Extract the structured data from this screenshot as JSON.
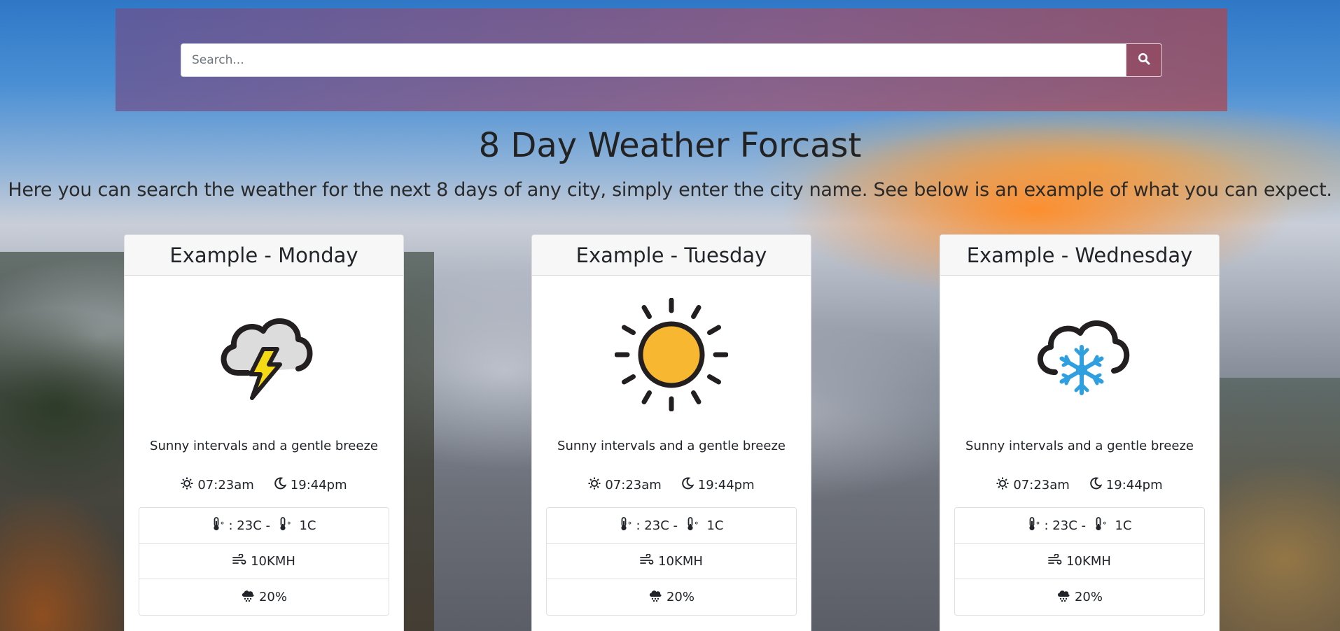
{
  "search": {
    "placeholder": "Search...",
    "button_icon": "search-icon"
  },
  "page": {
    "title": "8 Day Weather Forcast",
    "subtitle": "Here you can search the weather for the next 8 days of any city, simply enter the city name. See below is an example of what you can expect."
  },
  "cards": [
    {
      "title": "Example - Monday",
      "weather_icon": "thunderstorm-icon",
      "description": "Sunny intervals and a gentle breeze",
      "sunrise": "07:23am",
      "sunset": "19:44pm",
      "temp_label": ": 23C - ",
      "temp_low": " 1C",
      "wind": "10KMH",
      "rain": "20%"
    },
    {
      "title": "Example - Tuesday",
      "weather_icon": "sun-icon",
      "description": "Sunny intervals and a gentle breeze",
      "sunrise": "07:23am",
      "sunset": "19:44pm",
      "temp_label": ": 23C - ",
      "temp_low": " 1C",
      "wind": "10KMH",
      "rain": "20%"
    },
    {
      "title": "Example - Wednesday",
      "weather_icon": "snow-cloud-icon",
      "description": "Sunny intervals and a gentle breeze",
      "sunrise": "07:23am",
      "sunset": "19:44pm",
      "temp_label": ": 23C - ",
      "temp_low": " 1C",
      "wind": "10KMH",
      "rain": "20%"
    }
  ],
  "colors": {
    "sun_fill": "#f7b731",
    "bolt_fill": "#f5d915",
    "snow_blue": "#2f9fe0",
    "cloud_fill": "#dcdcdc",
    "outline": "#231f20"
  }
}
